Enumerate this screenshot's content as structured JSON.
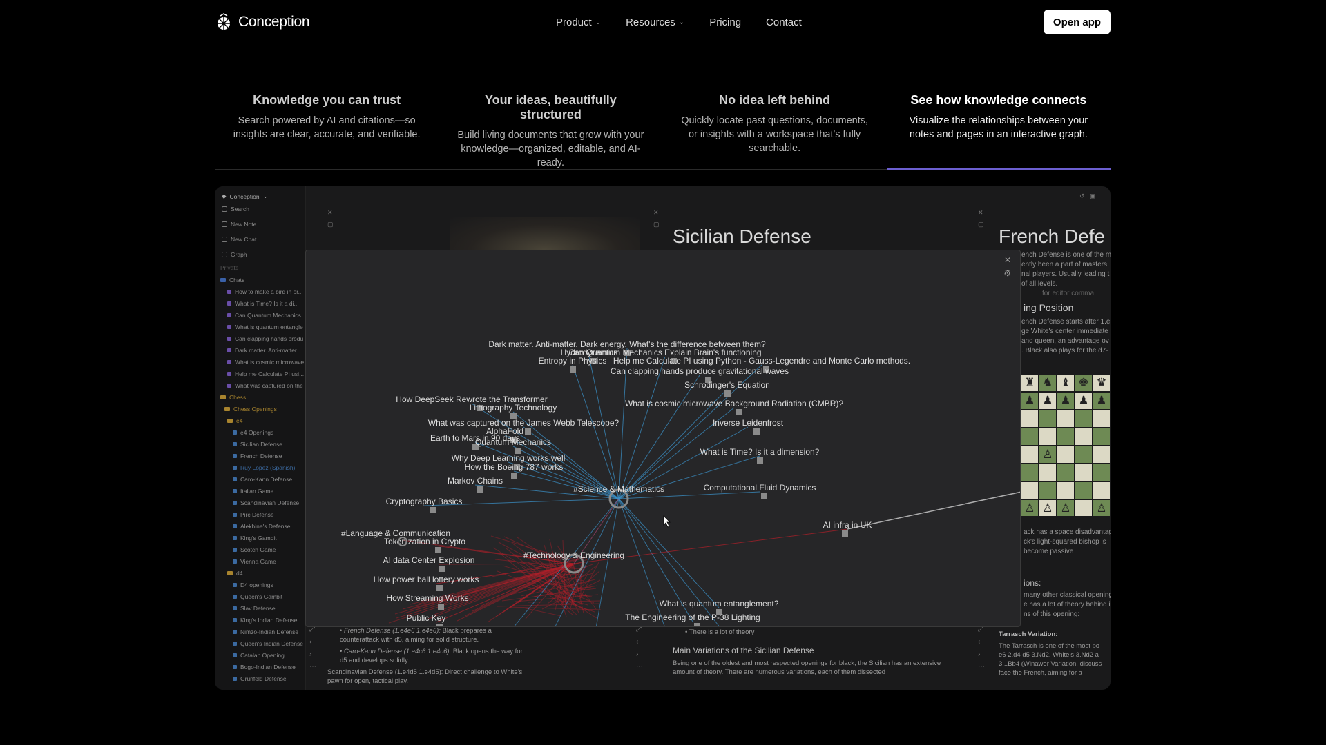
{
  "nav": {
    "brand": "Conception",
    "menu": [
      {
        "label": "Product",
        "has_dropdown": true
      },
      {
        "label": "Resources",
        "has_dropdown": true
      },
      {
        "label": "Pricing",
        "has_dropdown": false
      },
      {
        "label": "Contact",
        "has_dropdown": false
      }
    ],
    "cta": "Open app"
  },
  "features": [
    {
      "title": "Knowledge you can trust",
      "desc": "Search powered by AI and citations—so insights are clear, accurate, and verifiable.",
      "active": false
    },
    {
      "title": "Your ideas, beautifully structured",
      "desc": "Build living documents that grow with your knowledge—organized, editable, and AI-ready.",
      "active": false
    },
    {
      "title": "No idea left behind",
      "desc": "Quickly locate past questions, documents, or insights with a workspace that's fully searchable.",
      "active": false
    },
    {
      "title": "See how knowledge connects",
      "desc": "Visualize the relationships between your notes and pages in an interactive graph.",
      "active": true
    }
  ],
  "colors": {
    "accent": "#6c5fd0",
    "graph_science": "#3b8fc4",
    "graph_tech": "#b3202a"
  },
  "app": {
    "workspace": "Conception",
    "sidebar_actions": [
      "Search",
      "New Note",
      "New Chat",
      "Graph"
    ],
    "section_private": "Private",
    "chats_folder": "Chats",
    "chats": [
      "How to make a bird in or...",
      "What is Time? Is it a di...",
      "Can Quantum Mechanics",
      "What is quantum entangle",
      "Can clapping hands produ",
      "Dark matter. Anti-matter...",
      "What is cosmic microwave",
      "Help me Calculate PI usi...",
      "What was captured on the"
    ],
    "chess_folder": "Chess",
    "chess_openings_folder": "Chess Openings",
    "e4_folder": "e4",
    "e4_items": [
      "e4 Openings",
      "Sicilian Defense",
      "French Defense",
      "Ruy Lopez (Spanish)",
      "Caro-Kann Defense",
      "Italian Game",
      "Scandinavian Defense",
      "Pirc Defense",
      "Alekhine's Defense",
      "King's Gambit",
      "Scotch Game",
      "Vienna Game"
    ],
    "d4_folder": "d4",
    "d4_items": [
      "D4 openings",
      "Queen's Gambit",
      "Slav Defense",
      "King's Indian Defense",
      "Nimzo-Indian Defense",
      "Queen's Indian Defense",
      "Catalan Opening",
      "Bogo-Indian Defense",
      "Grunfeld Defense"
    ],
    "pane2_title": "Sicilian Defense",
    "pane3_title": "French Defe",
    "pane3_text": [
      "ench Defense is one of the m",
      "ently been a part of masters",
      "nal players. Usually leading t",
      "of all levels."
    ],
    "pane3_hint": "for editor comma",
    "pane3_heading": "ing Position",
    "pane3_text2": [
      "ench Defense starts after 1.e",
      "ge White's center immediate",
      "and queen, an advantage ov",
      ". Black also plays for the d7-"
    ],
    "pane3_text3": [
      "ack has a space disadvantag",
      "ck's light-squared bishop is",
      "become passive"
    ],
    "pane3_heading2": "ions:",
    "pane3_text4": [
      "many other classical openings",
      "e has a lot of theory behind i",
      "ns of this opening:"
    ],
    "tarrasch_title": "Tarrasch Variation:",
    "tarrasch_text": [
      "The Tarrasch is one of the most po",
      "e6 2.d4 d5 3.Nd2. White's 3.Nd2 a",
      "3...Bb4 (Winawer Variation, discuss",
      "face the French, aiming for a"
    ],
    "pane1_bullets": [
      {
        "name": "French Defense (1.e4e6 1.e4e6):",
        "text": "Black prepares a counterattack with d5, aiming for solid structure."
      },
      {
        "name": "Caro-Kann Defense (1.e4c6 1.e4c6):",
        "text": "Black opens the way for d5 and develops solidly."
      }
    ],
    "pane1_bottom": "Scandinavian Defense (1.e4d5 1.e4d5): Direct challenge to White's pawn for open, tactical play.",
    "pane2_bullet": "There is a lot of theory",
    "pane2_heading": "Main Variations of the Sicilian Defense",
    "pane2_text": "Being one of the oldest and most respected openings for black, the Sicilian has an extensive amount of theory. There are numerous variations, each of them dissected"
  },
  "graph": {
    "hubs": [
      {
        "label": "#Science & Mathematics",
        "color": "blue"
      },
      {
        "label": "#Technology & Engineering",
        "color": "red"
      },
      {
        "label": "#Language & Communication",
        "color": "red"
      }
    ],
    "science_nodes": [
      "Dark matter. Anti-matter. Dark energy. What's the difference between them?",
      "Hydrodynamics",
      "Can Quantum Mechanics Explain Brain's functioning",
      "Entropy in Physics",
      "Help me Calculate PI using Python - Gauss-Legendre and Monte Carlo methods.",
      "Can clapping hands produce gravitational waves",
      "Schrodinger's Equation",
      "What is cosmic microwave Background Radiation (CMBR)?",
      "Inverse Leidenfrost",
      "What is Time? Is it a dimension?",
      "Computational Fluid Dynamics",
      "How DeepSeek Rewrote the Transformer",
      "Lithography Technology",
      "What was captured on the James Webb Telescope?",
      "AlphaFold",
      "Earth to Mars in 90 days",
      "Quantum Mechanics",
      "Why Deep Learning works well",
      "How the Boeing 787 works",
      "Markov Chains",
      "Cryptography Basics",
      "What is quantum entanglement?",
      "The Engineering of the P-38 Lighting"
    ],
    "tech_nodes": [
      "AI infra in UK",
      "Tokenization in Crypto",
      "AI data Center Explosion",
      "How power ball lottery works",
      "How Streaming Works",
      "Public Key"
    ]
  }
}
